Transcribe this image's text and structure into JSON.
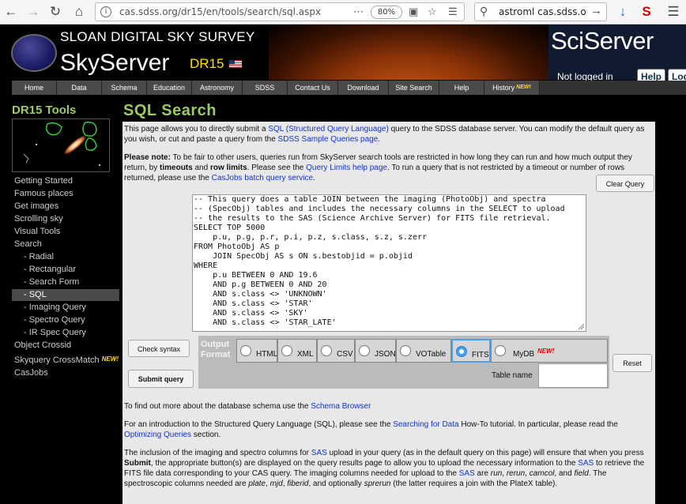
{
  "browser": {
    "url": "cas.sdss.org/dr15/en/tools/search/sql.aspx",
    "zoom": "80%",
    "search_text": "astroml cas.sdss.org f"
  },
  "header": {
    "site_title": "SLOAN DIGITAL SKY SURVEY",
    "site_name": "SkyServer",
    "release": "DR15",
    "sciserver_logo": "SciServer",
    "login_status": "Not logged in",
    "help_label": "Help",
    "login_label": "Log"
  },
  "nav": {
    "items": [
      "Home",
      "Data",
      "Schema",
      "Education",
      "Astronomy",
      "SDSS",
      "Contact Us",
      "Download",
      "Site Search",
      "Help",
      "History"
    ],
    "new_tag": "NEW!"
  },
  "sidebar": {
    "title": "DR15 Tools",
    "items": [
      "Getting Started",
      "Famous places",
      "Get images",
      "Scrolling sky",
      "Visual Tools",
      "Search",
      "- Radial",
      "- Rectangular",
      "- Search Form",
      "- SQL",
      "- Imaging Query",
      "- Spectro Query",
      "- IR Spec Query",
      "Object Crossid",
      "Skyquery CrossMatch",
      "CasJobs"
    ],
    "new_tag": "NEW!"
  },
  "main": {
    "title": "SQL Search",
    "intro": {
      "t1": "This page allows you to directly submit a ",
      "l1": "SQL (Structured Query Language)",
      "t2": " query to the SDSS database server. You can modify the default query as you wish, or cut and paste a query from the ",
      "l2": "SDSS Sample Queries page",
      "t3": "."
    },
    "note": {
      "b1": "Please note:",
      "t1": " To be fair to other users, queries run from SkyServer search tools are restricted in how long they can run and how much output they return, by ",
      "b2": "timeouts",
      "t2": " and ",
      "b3": "row limits",
      "t3": ". Please see the ",
      "l1": "Query Limits help page",
      "t4": ". To run a query that is not restricted by a timeout or number of rows returned, please use the ",
      "l2": "CasJobs batch query service",
      "t5": "."
    },
    "clear_query_label": "Clear Query",
    "query_text": "-- This query does a table JOIN between the imaging (PhotoObj) and spectra\n-- (SpecObj) tables and includes the necessary columns in the SELECT to upload\n-- the results to the SAS (Science Archive Server) for FITS file retrieval.\nSELECT TOP 5000\n    p.u, p.g, p.r, p.i, p.z, s.class, s.z, s.zerr\nFROM PhotoObj AS p\n    JOIN SpecObj AS s ON s.bestobjid = p.objid\nWHERE\n    p.u BETWEEN 0 AND 19.6\n    AND p.g BETWEEN 0 AND 20\n    AND s.class <> 'UNKNOWN'\n    AND s.class <> 'STAR'\n    AND s.class <> 'SKY'\n    AND s.class <> 'STAR_LATE'",
    "check_syntax_label": "Check syntax",
    "submit_label": "Submit query",
    "reset_label": "Reset",
    "output_format_label": "Output Format",
    "formats": [
      "HTML",
      "XML",
      "CSV",
      "JSON",
      "VOTable",
      "FITS",
      "MyDB"
    ],
    "selected_format": "FITS",
    "mydb_new": "NEW!",
    "table_name_label": "Table name",
    "table_name_value": "",
    "schema": {
      "t1": "To find out more about the database schema use the ",
      "l1": "Schema Browser"
    },
    "howto": {
      "t1": "For an introduction to the Structured Query Language (SQL), please see the ",
      "l1": "Searching for Data",
      "t2": " How-To tutorial. In particular, please read the ",
      "l2": "Optimizing Queries",
      "t3": " section."
    },
    "sas": {
      "t1": "The inclusion of the imaging and spectro columns for ",
      "l1": "SAS",
      "t2": " upload in your query (as in the default query on this page) will ensure that when you press ",
      "b1": "Submit",
      "t3": ", the appropriate button(s) are displayed on the query results page to allow you to upload the necessary information to the ",
      "l2": "SAS",
      "t4": " to retrieve the FITS file data corresponding to your CAS query. The imaging columns needed for upload to the ",
      "l3": "SAS",
      "t5": " are ",
      "i1": "run",
      "t6": ", ",
      "i2": "rerun",
      "t7": ", ",
      "i3": "camcol",
      "t8": ", and ",
      "i4": "field",
      "t9": ". The spectroscopic columns needed are ",
      "i5": "plate",
      "t10": ", ",
      "i6": "mjd",
      "t11": ", ",
      "i7": "fiberid",
      "t12": ", and optionally ",
      "i8": "sprerun",
      "t13": " (the latter requires a join with the PlateX table)."
    }
  }
}
